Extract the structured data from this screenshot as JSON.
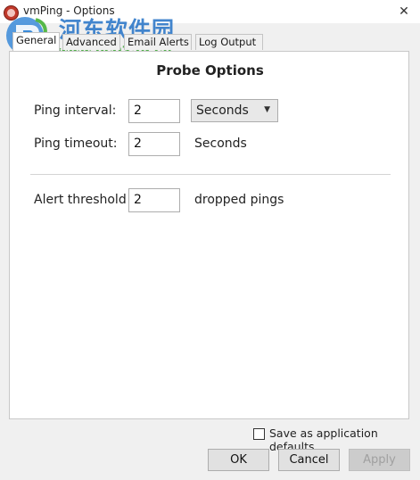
{
  "window": {
    "title": "vmPing - Options",
    "close_glyph": "✕"
  },
  "watermark": {
    "chinese": "河东软件园",
    "url": "www.pc0359.cn"
  },
  "tabs": [
    {
      "label": "General",
      "active": true
    },
    {
      "label": "Advanced",
      "active": false
    },
    {
      "label": "Email Alerts",
      "active": false
    },
    {
      "label": "Log Output",
      "active": false
    }
  ],
  "probe": {
    "title": "Probe Options",
    "ping_interval": {
      "label": "Ping interval:",
      "value": "2",
      "unit_selected": "Seconds"
    },
    "ping_timeout": {
      "label": "Ping timeout:",
      "value": "2",
      "unit": "Seconds"
    },
    "alert_threshold": {
      "label": "Alert threshold",
      "value": "2",
      "unit": "dropped pings"
    }
  },
  "footer": {
    "save_defaults_label": "Save as application defaults",
    "save_defaults_checked": false,
    "ok_label": "OK",
    "cancel_label": "Cancel",
    "apply_label": "Apply",
    "apply_enabled": false
  }
}
